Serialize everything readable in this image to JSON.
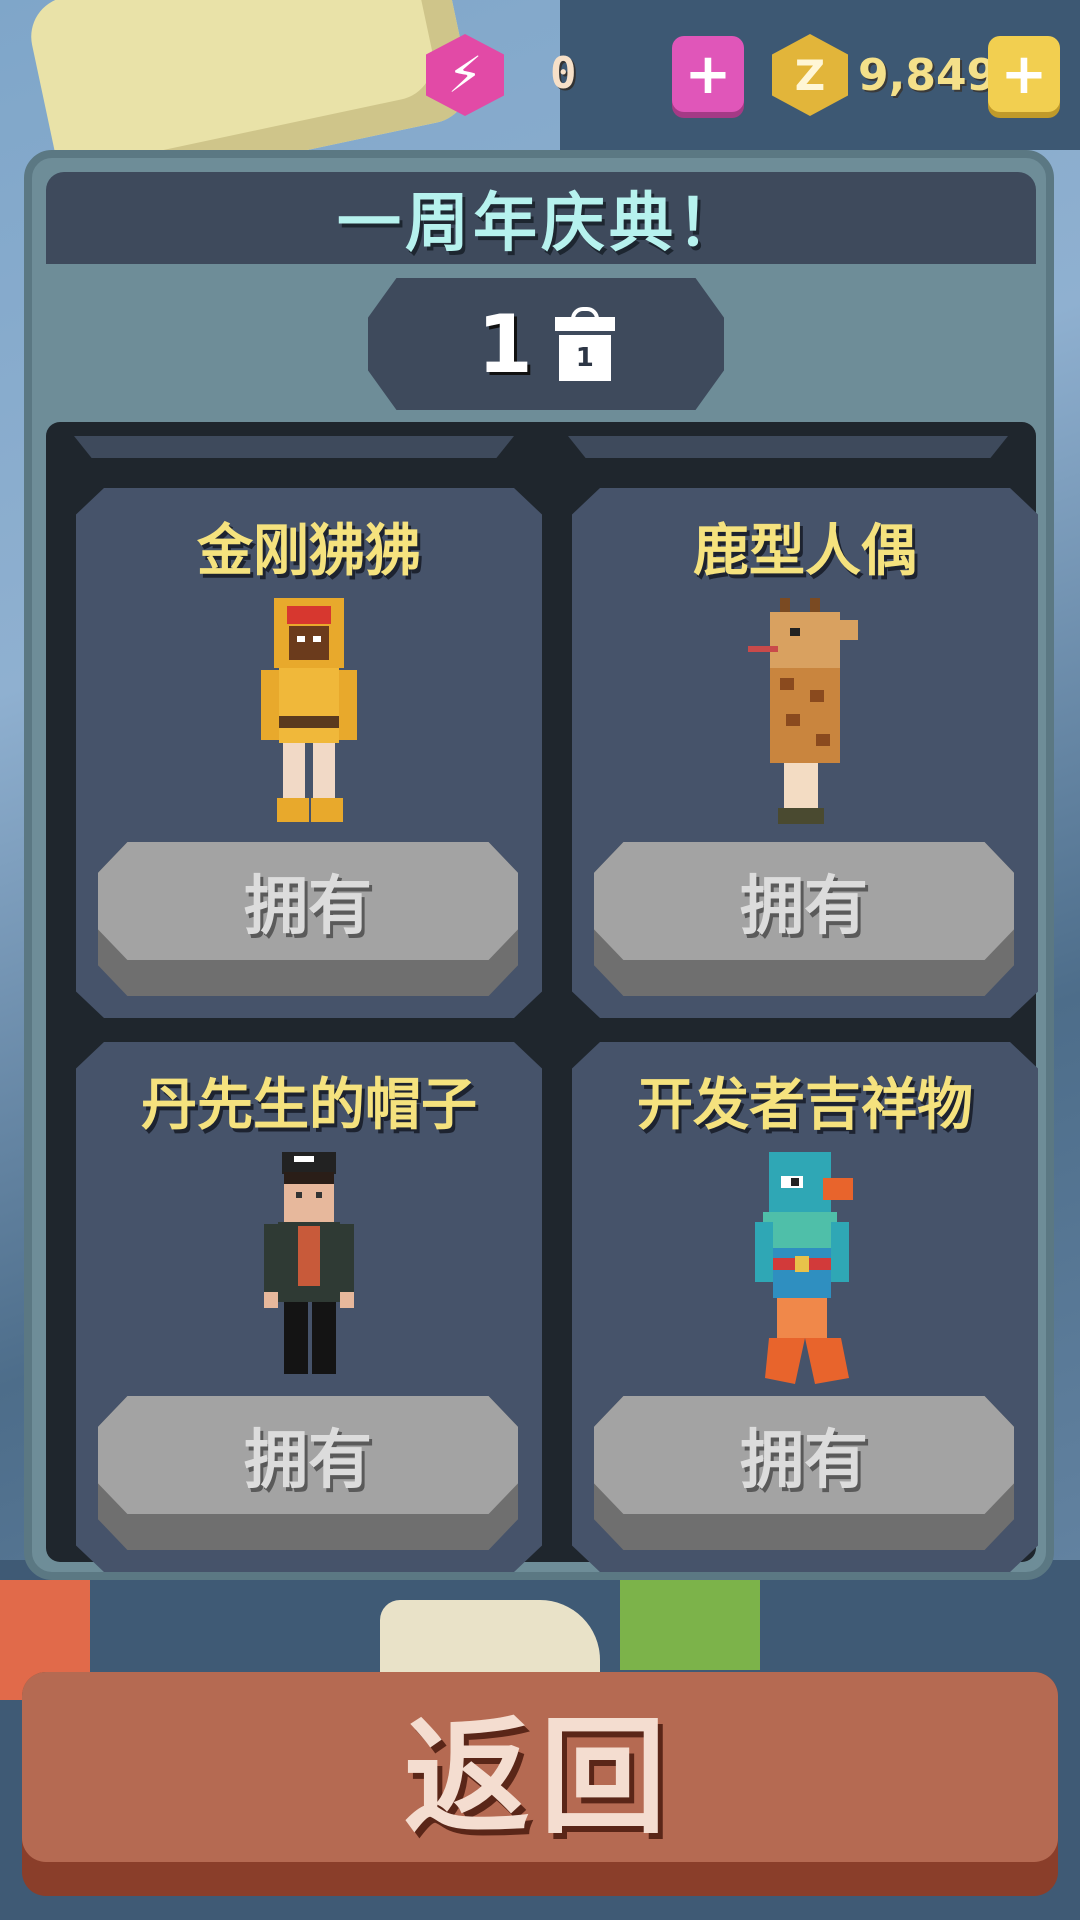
{
  "currency": {
    "energy_icon": "lightning-gem-icon",
    "energy_value": "0",
    "coin_icon": "zoo-coin-icon",
    "coin_symbol": "Z",
    "coin_value": "9,849",
    "plus_symbol": "+"
  },
  "panel": {
    "title": "一周年庆典！",
    "counter_value": "1",
    "gift_number": "1",
    "gift_icon": "gift-box-icon"
  },
  "items": [
    {
      "name": "金刚狒狒",
      "button_label": "拥有",
      "figure": "mandrill-costume-figure"
    },
    {
      "name": "鹿型人偶",
      "button_label": "拥有",
      "figure": "giraffe-costume-figure"
    },
    {
      "name": "丹先生的帽子",
      "button_label": "拥有",
      "figure": "mr-dan-hat-figure"
    },
    {
      "name": "开发者吉祥物",
      "button_label": "拥有",
      "figure": "developer-mascot-figure"
    }
  ],
  "back_button": {
    "label": "返回"
  },
  "colors": {
    "title_text": "#b6f2ee",
    "item_name": "#f5e27e",
    "back_button": "#b56a52",
    "energy": "#e24aa6",
    "coin": "#e2b53a"
  }
}
